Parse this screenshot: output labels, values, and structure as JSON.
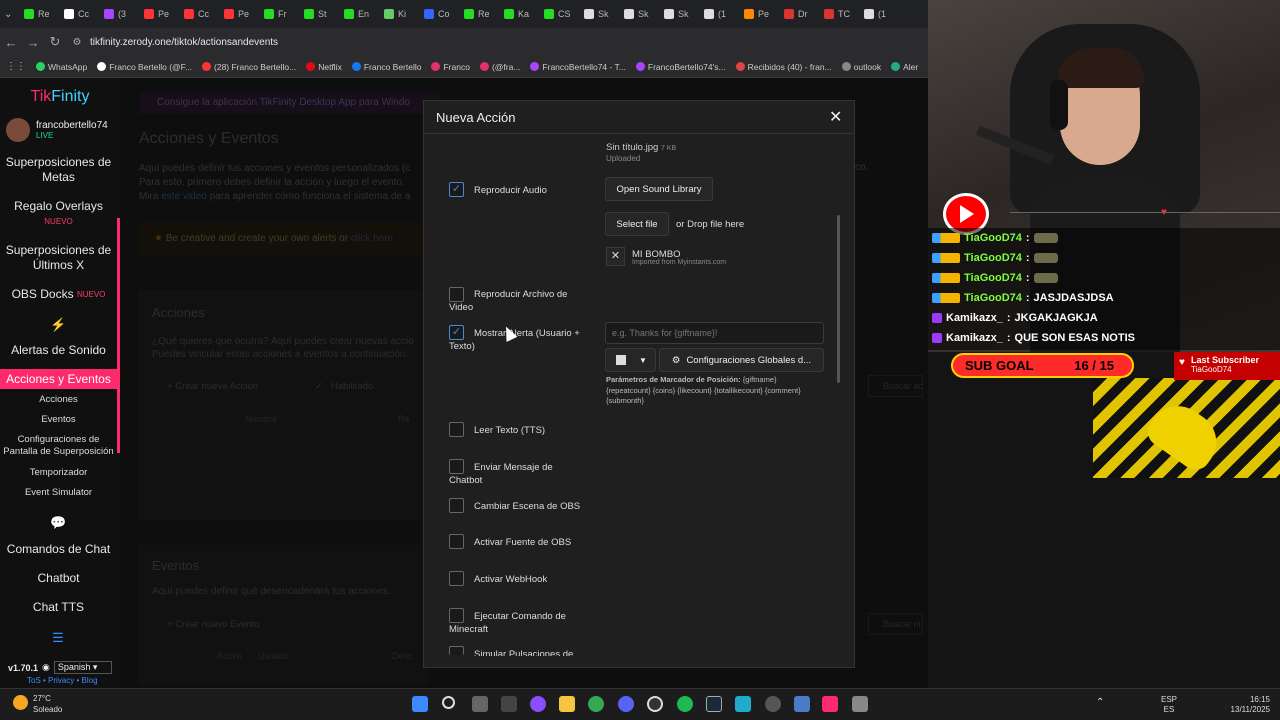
{
  "browser": {
    "tabs": [
      "Re",
      "Cc",
      "(3",
      "Pe",
      "Cc",
      "Pe",
      "Fr",
      "St",
      "En",
      "Ki",
      "Co",
      "Re",
      "Ka",
      "CS",
      "Sk",
      "Sk",
      "Sk",
      "(1",
      "Pe",
      "Dr",
      "TC",
      "(1"
    ],
    "url": "tikfinity.zerody.one/tiktok/actionsandevents",
    "bookmarks": [
      "WhatsApp",
      "Franco Bertello (@F...",
      "(28) Franco Bertello...",
      "Netflix",
      "Franco Bertello",
      "Franco",
      "(@fra...",
      "FrancoBertello74 - T...",
      "FrancoBertello74's...",
      "Recibidos (40) - fran...",
      "outlook",
      "Aler"
    ]
  },
  "sidebar": {
    "brand_prefix": "Tik",
    "brand_suffix": "Finity",
    "username": "francobertello74",
    "live": "LIVE",
    "items": [
      {
        "label": "Superposiciones de Metas"
      },
      {
        "label": "Regalo Overlays",
        "badge": "NUEVO"
      },
      {
        "label": "Superposiciones de Últimos X"
      },
      {
        "label": "OBS Docks",
        "badge": "NUEVO"
      },
      {
        "label": "Alertas de Sonido"
      },
      {
        "label": "Acciones y Eventos"
      },
      {
        "label": "Comandos de Chat"
      },
      {
        "label": "Chatbot"
      },
      {
        "label": "Chat TTS"
      }
    ],
    "subitems": [
      "Acciones",
      "Eventos",
      "Configuraciones de Pantalla de Superposición",
      "Temporizador",
      "Event Simulator"
    ],
    "version": "v1.70.1",
    "language": "Spanish",
    "footer_links": "ToS • Privacy • Blog"
  },
  "background": {
    "banner_prefix": "Consigue la aplicación",
    "banner_link": "TikFinity Desktop App",
    "banner_suffix": "para Windo",
    "heading": "Acciones y Eventos",
    "p1": "Aquí puedes definir tus acciones y eventos personalizados (c",
    "p2": "Para esto, primero debes definir la acción y luego el evento.",
    "p3_prefix": "Mira",
    "p3_link": "este video",
    "p3_suffix": "para aprender cómo funciona el sistema de a",
    "trailing": "co.",
    "creative_prefix": "Be creative and create your own alerts or",
    "creative_link": "click here",
    "acciones_title": "Acciones",
    "acciones_q1": "¿Qué quieres que ocurra? Aquí puedes crear nuevas accio",
    "acciones_q2": "Puedes vincular estas acciones a eventos a continuación.",
    "create_action": "Crear nueva Acción",
    "enabled": "Habilitado",
    "search_actions": "Buscar acción, acción...",
    "col_nombre": "Nombre",
    "col_re": "Re",
    "eventos_title": "Eventos",
    "eventos_desc": "Aquí puedes definir qué desencadenará tus acciones.",
    "create_event": "Crear nuevo Evento",
    "search_events": "Buscar nuevo evento...",
    "col_activo": "Activo",
    "col_usuario": "Usuario",
    "col_desc": "Desc"
  },
  "modal": {
    "title": "Nueva Acción",
    "uploaded_file": "Sin título.jpg",
    "uploaded_size": "7 KB",
    "uploaded_status": "Uploaded",
    "options": [
      {
        "label": "Reproducir Audio",
        "checked": true
      },
      {
        "label": "Reproducir Archivo de Video",
        "checked": false
      },
      {
        "label": "Mostrar Alerta (Usuario + Texto)",
        "checked": true
      },
      {
        "label": "Leer Texto (TTS)",
        "checked": false
      },
      {
        "label": "Enviar Mensaje de Chatbot",
        "checked": false
      },
      {
        "label": "Cambiar Escena de OBS",
        "checked": false
      },
      {
        "label": "Activar Fuente de OBS",
        "checked": false
      },
      {
        "label": "Activar WebHook",
        "checked": false
      },
      {
        "label": "Ejecutar Comando de Minecraft",
        "checked": false
      },
      {
        "label": "Simular Pulsaciones de",
        "checked": false
      }
    ],
    "open_sound_library": "Open Sound Library",
    "select_file": "Select file",
    "drop_text": "or Drop file here",
    "sound_name": "MI BOMBO",
    "sound_source": "Imported from Myinstants.com",
    "alert_placeholder": "e.g. Thanks for {giftname}!",
    "global_settings": "Configuraciones Globales d...",
    "placeholders_title": "Parámetros de Marcador de Posición:",
    "placeholders_1": "{giftname}",
    "placeholders_2": "{repeatcount} {coins} {likecount} {totallikecount} {comment}",
    "placeholders_3": "{submonth}"
  },
  "stream": {
    "chat": [
      {
        "user": "TiaGooD74",
        "text": "",
        "color": "#7cff3a"
      },
      {
        "user": "TiaGooD74",
        "text": "",
        "color": "#7cff3a"
      },
      {
        "user": "TiaGooD74",
        "text": "",
        "color": "#7cff3a"
      },
      {
        "user": "TiaGooD74",
        "text": "JASJDASJDSA",
        "color": "#7cff3a"
      },
      {
        "user": "Kamikazx_",
        "text": "JKGAKJAGKJA",
        "color": "#ffffff"
      },
      {
        "user": "Kamikazx_",
        "text": "QUE SON ESAS NOTIS",
        "color": "#ffffff"
      }
    ],
    "subgoal_label": "SUB GOAL",
    "subgoal_value": "16 / 15",
    "last_sub_label": "Last Subscriber",
    "last_sub_name": "TiaGooD74"
  },
  "taskbar": {
    "weather_temp": "27°C",
    "weather_desc": "Soleado",
    "lang_top": "ESP",
    "lang_bottom": "ES",
    "time": "16:15",
    "date": "13/11/2025"
  }
}
